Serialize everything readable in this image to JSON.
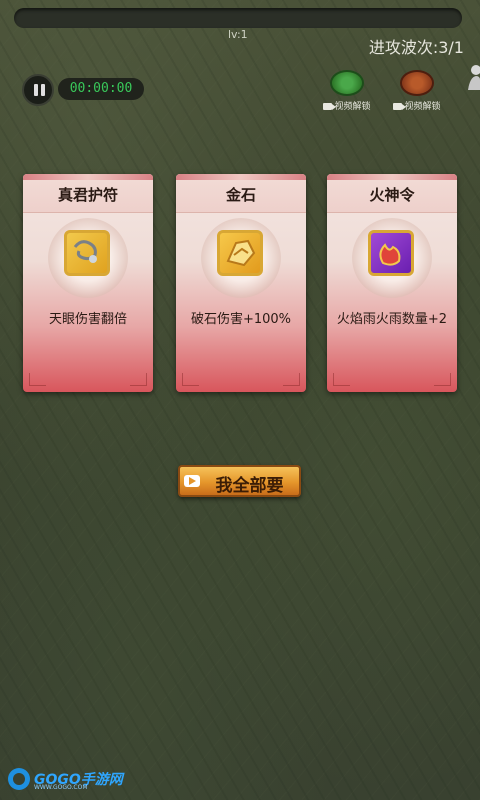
{
  "hud": {
    "level": "lv:1",
    "wave": "进攻波次:3/1",
    "timer": "00:00:00",
    "unlock_buttons": [
      {
        "label": "视频解锁",
        "color": "#2f7a2a"
      },
      {
        "label": "视频解锁",
        "color": "#8a3b1c"
      }
    ]
  },
  "cards": [
    {
      "title": "真君护符",
      "icon": "amulet-icon",
      "description": "天眼伤害翻倍"
    },
    {
      "title": "金石",
      "icon": "gold-stone-icon",
      "description": "破石伤害+100%"
    },
    {
      "title": "火神令",
      "icon": "fire-token-icon",
      "description": "火焰雨火雨数量+2"
    }
  ],
  "take_all_button": {
    "label": "我全部要"
  },
  "watermark": {
    "brand": "GOGO手游网",
    "url": "WWW.GOGO.COM"
  }
}
